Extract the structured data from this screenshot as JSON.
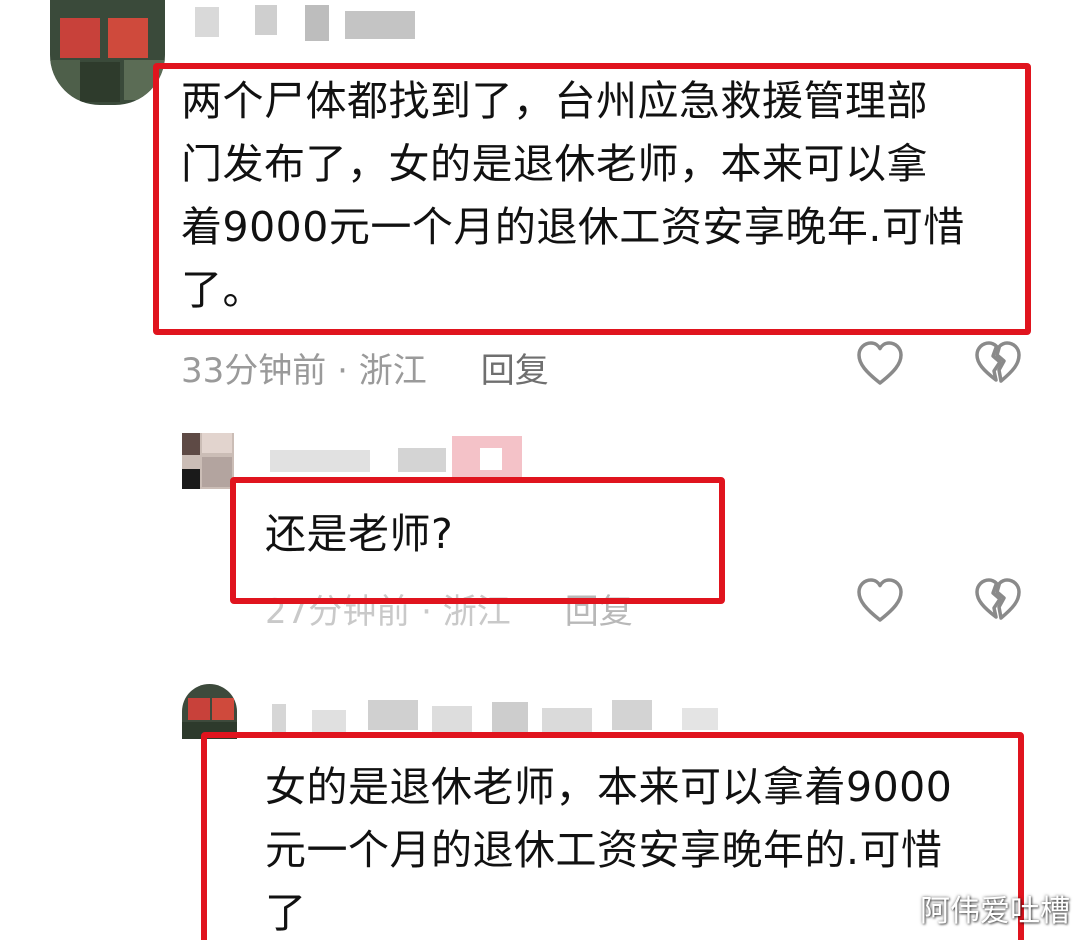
{
  "comments": [
    {
      "text": "两个尸体都找到了，台州应急救援管理部\n门发布了，女的是退休老师，本来可以拿\n着9000元一个月的退休工资安享晚年.可惜\n了。",
      "time": "33分钟前",
      "location": "浙江",
      "separator": " · ",
      "reply_label": "回复",
      "like_icon": "heart-outline-icon",
      "dislike_icon": "broken-heart-icon"
    },
    {
      "text": "还是老师?",
      "time": "27分钟前",
      "location": "浙江",
      "separator": " · ",
      "reply_label": "回复",
      "like_icon": "heart-outline-icon",
      "dislike_icon": "broken-heart-icon"
    },
    {
      "text": "女的是退休老师，本来可以拿着9000\n元一个月的退休工资安享晚年的.可惜\n了"
    }
  ],
  "watermark": "阿伟爱吐槽",
  "colors": {
    "highlight_border": "#e0141e",
    "meta_text": "#9a9a9a",
    "body_text": "#111111"
  }
}
